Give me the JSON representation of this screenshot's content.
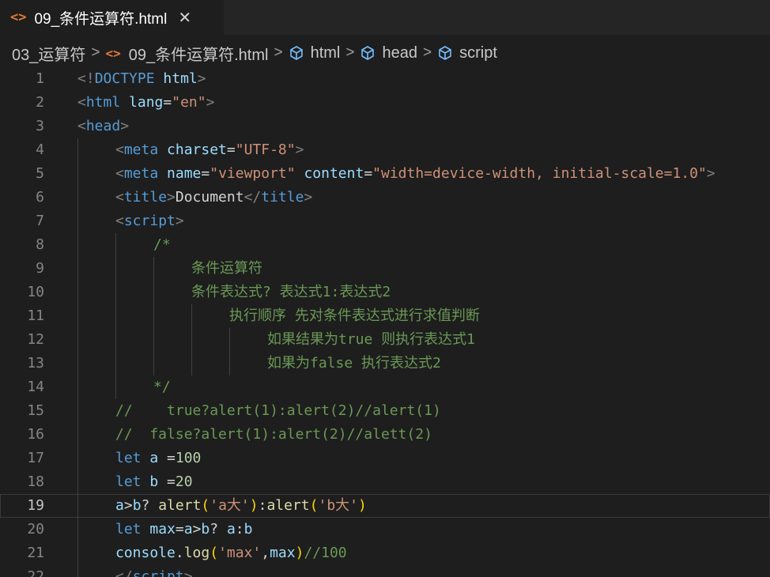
{
  "tab": {
    "icon": "<>",
    "title": "09_条件运算符.html",
    "close": "✕"
  },
  "breadcrumb": {
    "folder": "03_运算符",
    "file": "09_条件运算符.html",
    "html": "html",
    "head": "head",
    "script": "script"
  },
  "current_line": 19,
  "lines": [
    {
      "n": "1",
      "indent": 0,
      "tokens": [
        {
          "t": "<!",
          "c": "b"
        },
        {
          "t": "DOCTYPE",
          "c": "t"
        },
        {
          "t": " ",
          "c": "a"
        },
        {
          "t": "html",
          "c": "a"
        },
        {
          "t": ">",
          "c": "b"
        }
      ]
    },
    {
      "n": "2",
      "indent": 0,
      "tokens": [
        {
          "t": "<",
          "c": "b"
        },
        {
          "t": "html",
          "c": "t"
        },
        {
          "t": " ",
          "c": "a"
        },
        {
          "t": "lang",
          "c": "a"
        },
        {
          "t": "=",
          "c": "x"
        },
        {
          "t": "\"en\"",
          "c": "s"
        },
        {
          "t": ">",
          "c": "b"
        }
      ]
    },
    {
      "n": "3",
      "indent": 0,
      "tokens": [
        {
          "t": "<",
          "c": "b"
        },
        {
          "t": "head",
          "c": "t"
        },
        {
          "t": ">",
          "c": "b"
        }
      ]
    },
    {
      "n": "4",
      "indent": 1,
      "tokens": [
        {
          "t": "<",
          "c": "b"
        },
        {
          "t": "meta",
          "c": "t"
        },
        {
          "t": " charset",
          "c": "a"
        },
        {
          "t": "=",
          "c": "x"
        },
        {
          "t": "\"UTF-8\"",
          "c": "s"
        },
        {
          "t": ">",
          "c": "b"
        }
      ]
    },
    {
      "n": "5",
      "indent": 1,
      "tokens": [
        {
          "t": "<",
          "c": "b"
        },
        {
          "t": "meta",
          "c": "t"
        },
        {
          "t": " name",
          "c": "a"
        },
        {
          "t": "=",
          "c": "x"
        },
        {
          "t": "\"viewport\"",
          "c": "s"
        },
        {
          "t": " content",
          "c": "a"
        },
        {
          "t": "=",
          "c": "x"
        },
        {
          "t": "\"width=device-width, initial-scale=1.0\"",
          "c": "s"
        },
        {
          "t": ">",
          "c": "b"
        }
      ]
    },
    {
      "n": "6",
      "indent": 1,
      "tokens": [
        {
          "t": "<",
          "c": "b"
        },
        {
          "t": "title",
          "c": "t"
        },
        {
          "t": ">",
          "c": "b"
        },
        {
          "t": "Document",
          "c": "x"
        },
        {
          "t": "</",
          "c": "b"
        },
        {
          "t": "title",
          "c": "t"
        },
        {
          "t": ">",
          "c": "b"
        }
      ]
    },
    {
      "n": "7",
      "indent": 1,
      "tokens": [
        {
          "t": "<",
          "c": "b"
        },
        {
          "t": "script",
          "c": "t"
        },
        {
          "t": ">",
          "c": "b"
        }
      ]
    },
    {
      "n": "8",
      "indent": 2,
      "tokens": [
        {
          "t": "/*",
          "c": "c"
        }
      ]
    },
    {
      "n": "9",
      "indent": 3,
      "tokens": [
        {
          "t": "条件运算符",
          "c": "c"
        }
      ]
    },
    {
      "n": "10",
      "indent": 3,
      "tokens": [
        {
          "t": "条件表达式? 表达式1:表达式2",
          "c": "c"
        }
      ]
    },
    {
      "n": "11",
      "indent": 4,
      "tokens": [
        {
          "t": "执行顺序 先对条件表达式进行求值判断",
          "c": "c"
        }
      ]
    },
    {
      "n": "12",
      "indent": 5,
      "tokens": [
        {
          "t": "如果结果为true 则执行表达式1",
          "c": "c"
        }
      ]
    },
    {
      "n": "13",
      "indent": 5,
      "tokens": [
        {
          "t": "如果为false 执行表达式2",
          "c": "c"
        }
      ]
    },
    {
      "n": "14",
      "indent": 2,
      "tokens": [
        {
          "t": "*/",
          "c": "c"
        }
      ]
    },
    {
      "n": "15",
      "indent": 1,
      "tokens": [
        {
          "t": "//    true?alert(1):alert(2)//alert(1)",
          "c": "c"
        }
      ]
    },
    {
      "n": "16",
      "indent": 1,
      "tokens": [
        {
          "t": "//  false?alert(1):alert(2)//alett(2)",
          "c": "c"
        }
      ]
    },
    {
      "n": "17",
      "indent": 1,
      "tokens": [
        {
          "t": "let",
          "c": "k"
        },
        {
          "t": " a ",
          "c": "v"
        },
        {
          "t": "=",
          "c": "x"
        },
        {
          "t": "100",
          "c": "n"
        }
      ]
    },
    {
      "n": "18",
      "indent": 1,
      "tokens": [
        {
          "t": "let",
          "c": "k"
        },
        {
          "t": " b ",
          "c": "v"
        },
        {
          "t": "=",
          "c": "x"
        },
        {
          "t": "20",
          "c": "n"
        }
      ]
    },
    {
      "n": "19",
      "indent": 1,
      "tokens": [
        {
          "t": "a",
          "c": "v"
        },
        {
          "t": ">",
          "c": "x"
        },
        {
          "t": "b",
          "c": "v"
        },
        {
          "t": "? ",
          "c": "x"
        },
        {
          "t": "alert",
          "c": "f"
        },
        {
          "t": "(",
          "c": "p"
        },
        {
          "t": "'a大'",
          "c": "s"
        },
        {
          "t": ")",
          "c": "p"
        },
        {
          "t": ":",
          "c": "x"
        },
        {
          "t": "alert",
          "c": "f"
        },
        {
          "t": "(",
          "c": "p"
        },
        {
          "t": "'b大'",
          "c": "s"
        },
        {
          "t": ")",
          "c": "p"
        }
      ]
    },
    {
      "n": "20",
      "indent": 1,
      "tokens": [
        {
          "t": "let",
          "c": "k"
        },
        {
          "t": " max",
          "c": "v"
        },
        {
          "t": "=",
          "c": "x"
        },
        {
          "t": "a",
          "c": "v"
        },
        {
          "t": ">",
          "c": "x"
        },
        {
          "t": "b",
          "c": "v"
        },
        {
          "t": "? ",
          "c": "x"
        },
        {
          "t": "a",
          "c": "v"
        },
        {
          "t": ":",
          "c": "x"
        },
        {
          "t": "b",
          "c": "v"
        }
      ]
    },
    {
      "n": "21",
      "indent": 1,
      "tokens": [
        {
          "t": "console",
          "c": "v"
        },
        {
          "t": ".",
          "c": "x"
        },
        {
          "t": "log",
          "c": "f"
        },
        {
          "t": "(",
          "c": "p"
        },
        {
          "t": "'max'",
          "c": "s"
        },
        {
          "t": ",",
          "c": "x"
        },
        {
          "t": "max",
          "c": "v"
        },
        {
          "t": ")",
          "c": "p"
        },
        {
          "t": "//100",
          "c": "c"
        }
      ]
    },
    {
      "n": "22",
      "indent": 1,
      "tokens": [
        {
          "t": "</",
          "c": "b"
        },
        {
          "t": "script",
          "c": "t"
        },
        {
          "t": ">",
          "c": "b"
        }
      ]
    }
  ]
}
